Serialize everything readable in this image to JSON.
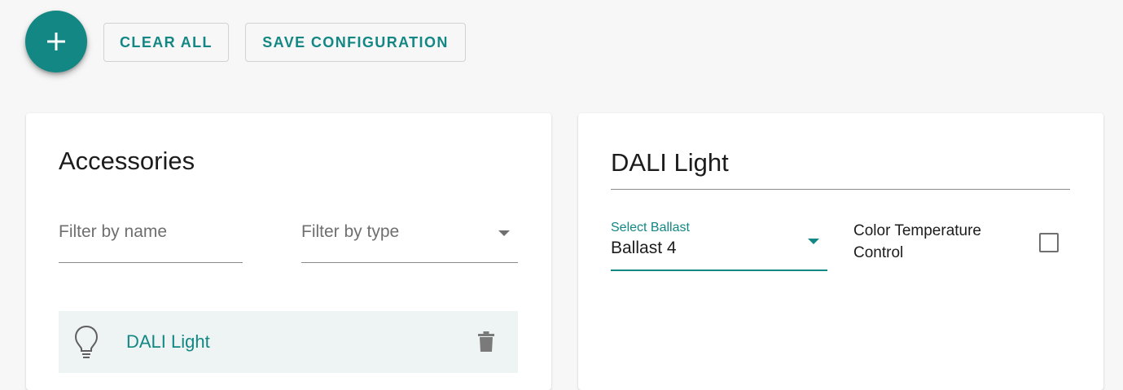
{
  "toolbar": {
    "add_icon": "plus-icon",
    "clear_all_label": "CLEAR ALL",
    "save_configuration_label": "SAVE CONFIGURATION"
  },
  "colors": {
    "accent": "#138784",
    "page_background": "#f7f7f7",
    "card_background": "#ffffff",
    "selected_row_background": "#eef4f3"
  },
  "accessories_panel": {
    "title": "Accessories",
    "filter_name": {
      "value": "",
      "placeholder": "Filter by name"
    },
    "filter_type": {
      "selected": "",
      "placeholder": "Filter by type"
    },
    "items": [
      {
        "label": "DALI Light",
        "icon": "lightbulb-outline-icon",
        "action_icon": "trash-icon",
        "selected": true
      }
    ]
  },
  "detail_panel": {
    "name_value": "DALI Light",
    "ballast_select": {
      "label": "Select Ballast",
      "value": "Ballast 4"
    },
    "color_temperature": {
      "label": "Color Temperature Control",
      "checked": false
    }
  }
}
